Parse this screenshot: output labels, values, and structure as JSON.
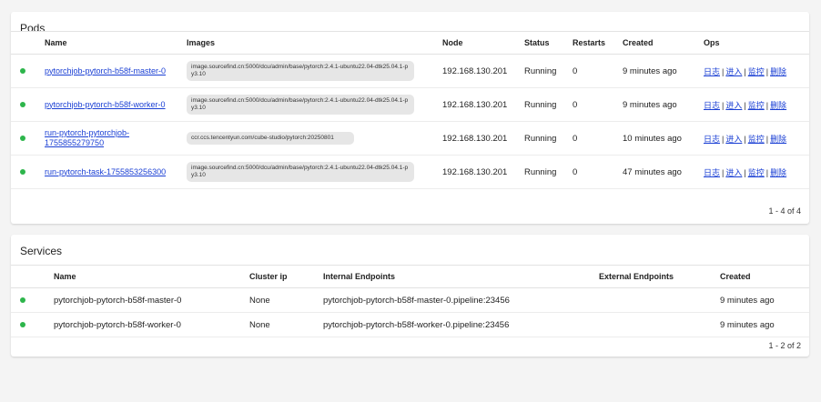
{
  "pods": {
    "title": "Pods",
    "columns": [
      "Name",
      "Images",
      "Node",
      "Status",
      "Restarts",
      "Created",
      "Ops"
    ],
    "rows": [
      {
        "name": "pytorchjob-pytorch-b58f-master-0",
        "image": "image.sourcefind.cn:5000/dcu/admin/base/pytorch:2.4.1-ubuntu22.04-dtk25.04.1-py3.10",
        "node": "192.168.130.201",
        "status": "Running",
        "restarts": "0",
        "created": "9 minutes ago"
      },
      {
        "name": "pytorchjob-pytorch-b58f-worker-0",
        "image": "image.sourcefind.cn:5000/dcu/admin/base/pytorch:2.4.1-ubuntu22.04-dtk25.04.1-py3.10",
        "node": "192.168.130.201",
        "status": "Running",
        "restarts": "0",
        "created": "9 minutes ago"
      },
      {
        "name": "run-pytorch-pytorchjob-1755855279750",
        "image": "ccr.ccs.tencentyun.com/cube-studio/pytorch:20250801",
        "node": "192.168.130.201",
        "status": "Running",
        "restarts": "0",
        "created": "10 minutes ago"
      },
      {
        "name": "run-pytorch-task-1755853256300",
        "image": "image.sourcefind.cn:5000/dcu/admin/base/pytorch:2.4.1-ubuntu22.04-dtk25.04.1-py3.10",
        "node": "192.168.130.201",
        "status": "Running",
        "restarts": "0",
        "created": "47 minutes ago"
      }
    ],
    "ops": [
      "日志",
      "进入",
      "监控",
      "删除"
    ],
    "separator": "|",
    "pagination": "1 - 4 of 4"
  },
  "services": {
    "title": "Services",
    "columns": [
      "Name",
      "Cluster ip",
      "Internal Endpoints",
      "External Endpoints",
      "Created"
    ],
    "rows": [
      {
        "name": "pytorchjob-pytorch-b58f-master-0",
        "cluster_ip": "None",
        "internal": "pytorchjob-pytorch-b58f-master-0.pipeline:23456",
        "external": "",
        "created": "9 minutes ago"
      },
      {
        "name": "pytorchjob-pytorch-b58f-worker-0",
        "cluster_ip": "None",
        "internal": "pytorchjob-pytorch-b58f-worker-0.pipeline:23456",
        "external": "",
        "created": "9 minutes ago"
      }
    ],
    "pagination": "1 - 2 of 2"
  },
  "colors": {
    "link": "#1a3fd4",
    "status_dot": "#2db54b",
    "pill_bg": "#e6e6e6"
  }
}
